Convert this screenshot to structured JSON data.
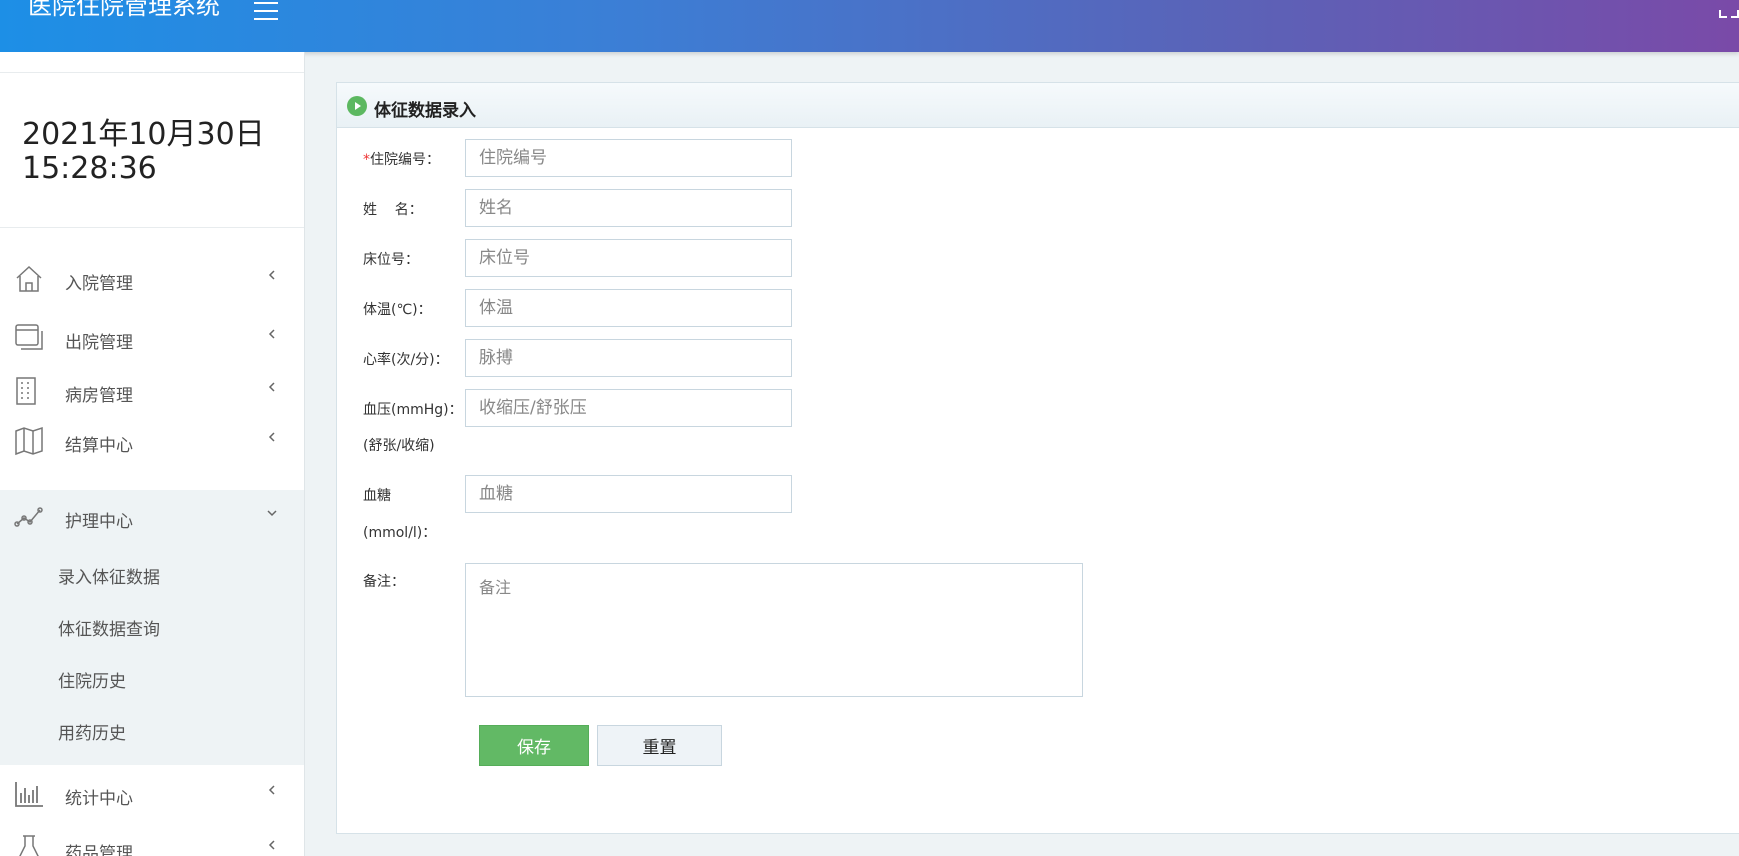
{
  "header": {
    "brand": "医院住院管理系统"
  },
  "sidebar": {
    "clock_date": "2021年10月30日",
    "clock_time": "15:28:36",
    "menu": [
      {
        "label": "入院管理",
        "icon": "home-icon"
      },
      {
        "label": "出院管理",
        "icon": "window-stack-icon"
      },
      {
        "label": "病房管理",
        "icon": "building-icon"
      },
      {
        "label": "结算中心",
        "icon": "map-icon"
      },
      {
        "label": "护理中心",
        "icon": "line-chart-icon",
        "expanded": true
      },
      {
        "label": "统计中心",
        "icon": "bar-chart-icon"
      },
      {
        "label": "药品管理",
        "icon": "flask-icon"
      }
    ],
    "nursing_sub": [
      "录入体征数据",
      "体征数据查询",
      "住院历史",
      "用药历史"
    ]
  },
  "form": {
    "title": "体征数据录入",
    "required_mark": "*",
    "fields": {
      "admission_no": {
        "label": "住院编号：",
        "placeholder": "住院编号"
      },
      "name": {
        "label": "姓    名：",
        "placeholder": "姓名"
      },
      "bed_no": {
        "label": "床位号：",
        "placeholder": "床位号"
      },
      "temperature": {
        "label": "体温(℃)：",
        "placeholder": "体温"
      },
      "heart_rate": {
        "label": "心率(次/分)：",
        "placeholder": "脉搏"
      },
      "blood_pressure": {
        "label": "血压(mmHg)：",
        "label2": "(舒张/收缩)",
        "placeholder": "收缩压/舒张压"
      },
      "blood_sugar": {
        "label": "血糖",
        "label2": "(mmol/l)：",
        "placeholder": "血糖"
      },
      "remark": {
        "label": "备注：",
        "placeholder": "备注"
      }
    },
    "save_label": "保存",
    "reset_label": "重置"
  },
  "colors": {
    "header_gradient_start": "#1d8fe6",
    "header_gradient_end": "#7a4aa8",
    "save_button": "#62b965",
    "required": "#e33333"
  }
}
